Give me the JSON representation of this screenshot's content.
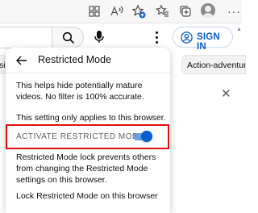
{
  "browser_toolbar": {
    "icons": [
      "tab-grid-icon",
      "read-aloud-icon",
      "add-favorite-icon",
      "favorites-icon",
      "collections-icon",
      "profile-avatar",
      "more-dots-icon"
    ],
    "more_label": "···"
  },
  "masthead": {
    "sign_in_label": "SIGN IN",
    "accent_color": "#065fd4"
  },
  "chips": {
    "left_partial": "sic",
    "right_partial": "Action-adventure"
  },
  "restricted_panel": {
    "title": "Restricted Mode",
    "description": "This helps hide potentially mature videos. No filter is 100% accurate.",
    "browser_note": "This setting only applies to this browser.",
    "toggle_label": "ACTIVATE RESTRICTED MODE",
    "toggle_on": true,
    "lock_description": "Restricted Mode lock prevents others from changing the Restricted Mode settings on this browser.",
    "lock_link": "Lock Restricted Mode on this browser",
    "highlight_color": "#e01010"
  },
  "close_glyph": "✕",
  "scroll_up_glyph": "▲"
}
